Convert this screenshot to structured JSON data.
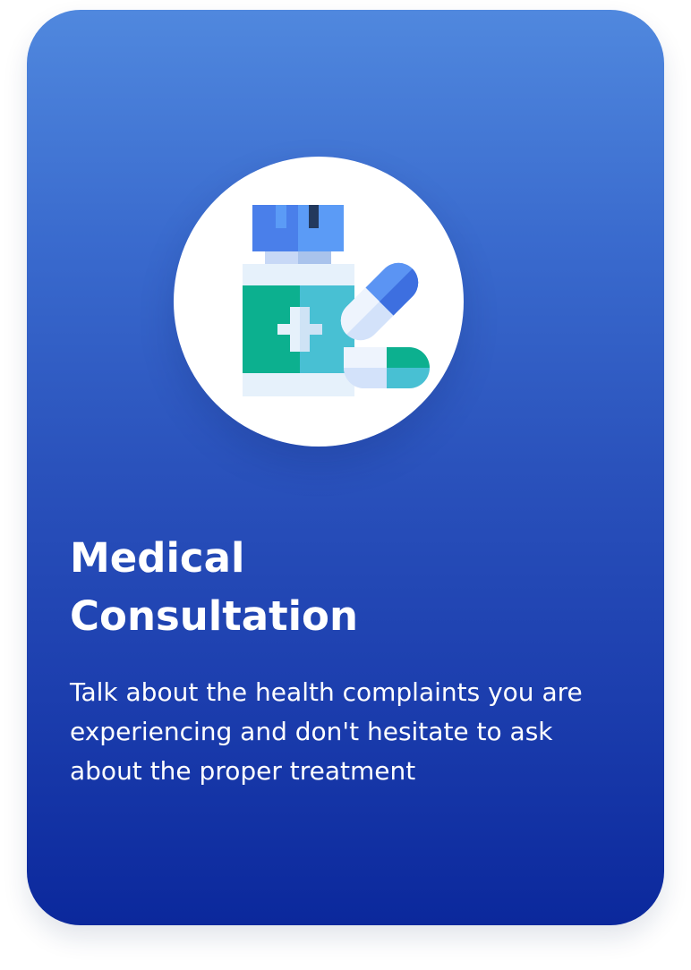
{
  "card": {
    "icon": "medicine-bottle-pills-icon",
    "title_line1": "Medical",
    "title_line2": "Consultation",
    "description": "Talk about the health complaints you are experiencing and don't hesitate to ask about the proper treatment"
  },
  "colors": {
    "gradient_top": "#5088de",
    "gradient_bottom": "#0b289c",
    "text": "#ffffff",
    "icon_background": "#ffffff"
  }
}
